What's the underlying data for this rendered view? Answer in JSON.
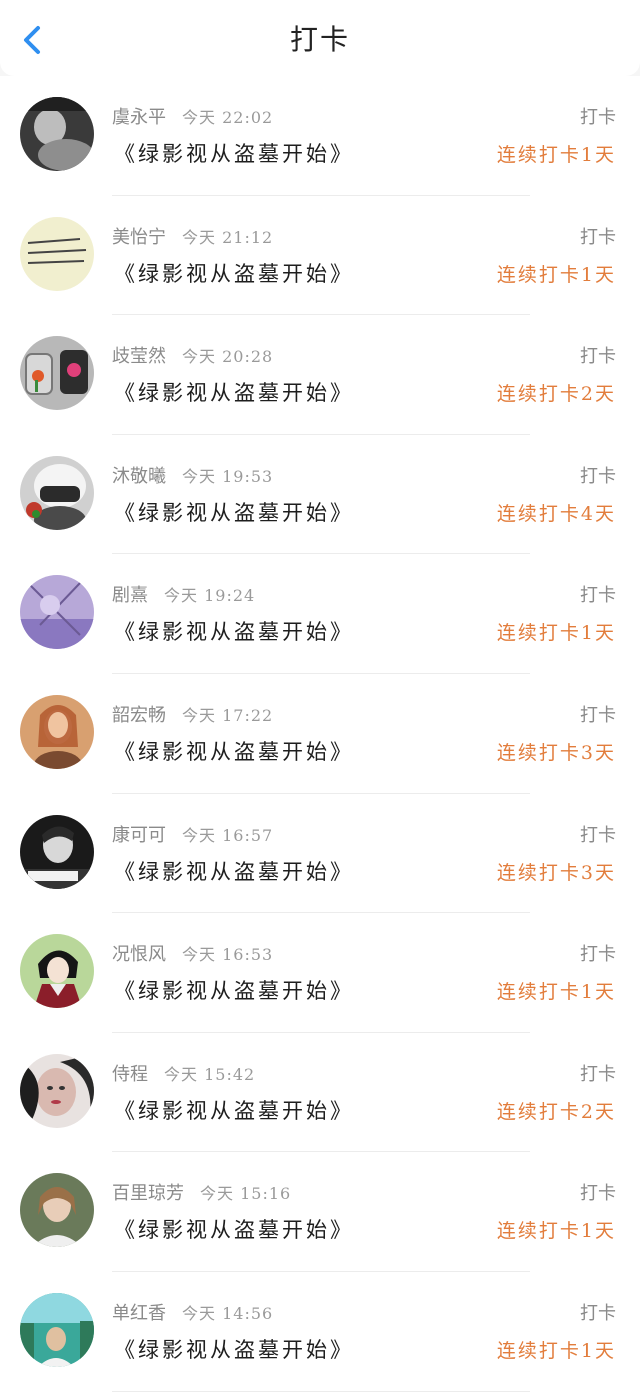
{
  "header": {
    "title": "打卡",
    "back_icon": "chevron-left-icon",
    "back_color": "#2f8ff0"
  },
  "colors": {
    "streak": "#e27d3c",
    "name": "#8a8a8a"
  },
  "items": [
    {
      "name": "虞永平",
      "time": "今天 22:02",
      "book": "《绿影视从盗墓开始》",
      "action": "打卡",
      "streak": "连续打卡1天",
      "avatar": "avatar-1"
    },
    {
      "name": "美怡宁",
      "time": "今天 21:12",
      "book": "《绿影视从盗墓开始》",
      "action": "打卡",
      "streak": "连续打卡1天",
      "avatar": "avatar-2"
    },
    {
      "name": "歧莹然",
      "time": "今天 20:28",
      "book": "《绿影视从盗墓开始》",
      "action": "打卡",
      "streak": "连续打卡2天",
      "avatar": "avatar-3"
    },
    {
      "name": "沐敬曦",
      "time": "今天 19:53",
      "book": "《绿影视从盗墓开始》",
      "action": "打卡",
      "streak": "连续打卡4天",
      "avatar": "avatar-4"
    },
    {
      "name": "剧熹",
      "time": "今天 19:24",
      "book": "《绿影视从盗墓开始》",
      "action": "打卡",
      "streak": "连续打卡1天",
      "avatar": "avatar-5"
    },
    {
      "name": "韶宏畅",
      "time": "今天 17:22",
      "book": "《绿影视从盗墓开始》",
      "action": "打卡",
      "streak": "连续打卡3天",
      "avatar": "avatar-6"
    },
    {
      "name": "康可可",
      "time": "今天 16:57",
      "book": "《绿影视从盗墓开始》",
      "action": "打卡",
      "streak": "连续打卡3天",
      "avatar": "avatar-7"
    },
    {
      "name": "况恨风",
      "time": "今天 16:53",
      "book": "《绿影视从盗墓开始》",
      "action": "打卡",
      "streak": "连续打卡1天",
      "avatar": "avatar-8"
    },
    {
      "name": "侍程",
      "time": "今天 15:42",
      "book": "《绿影视从盗墓开始》",
      "action": "打卡",
      "streak": "连续打卡2天",
      "avatar": "avatar-9"
    },
    {
      "name": "百里琼芳",
      "time": "今天 15:16",
      "book": "《绿影视从盗墓开始》",
      "action": "打卡",
      "streak": "连续打卡1天",
      "avatar": "avatar-10"
    },
    {
      "name": "单红香",
      "time": "今天 14:56",
      "book": "《绿影视从盗墓开始》",
      "action": "打卡",
      "streak": "连续打卡1天",
      "avatar": "avatar-11"
    }
  ]
}
